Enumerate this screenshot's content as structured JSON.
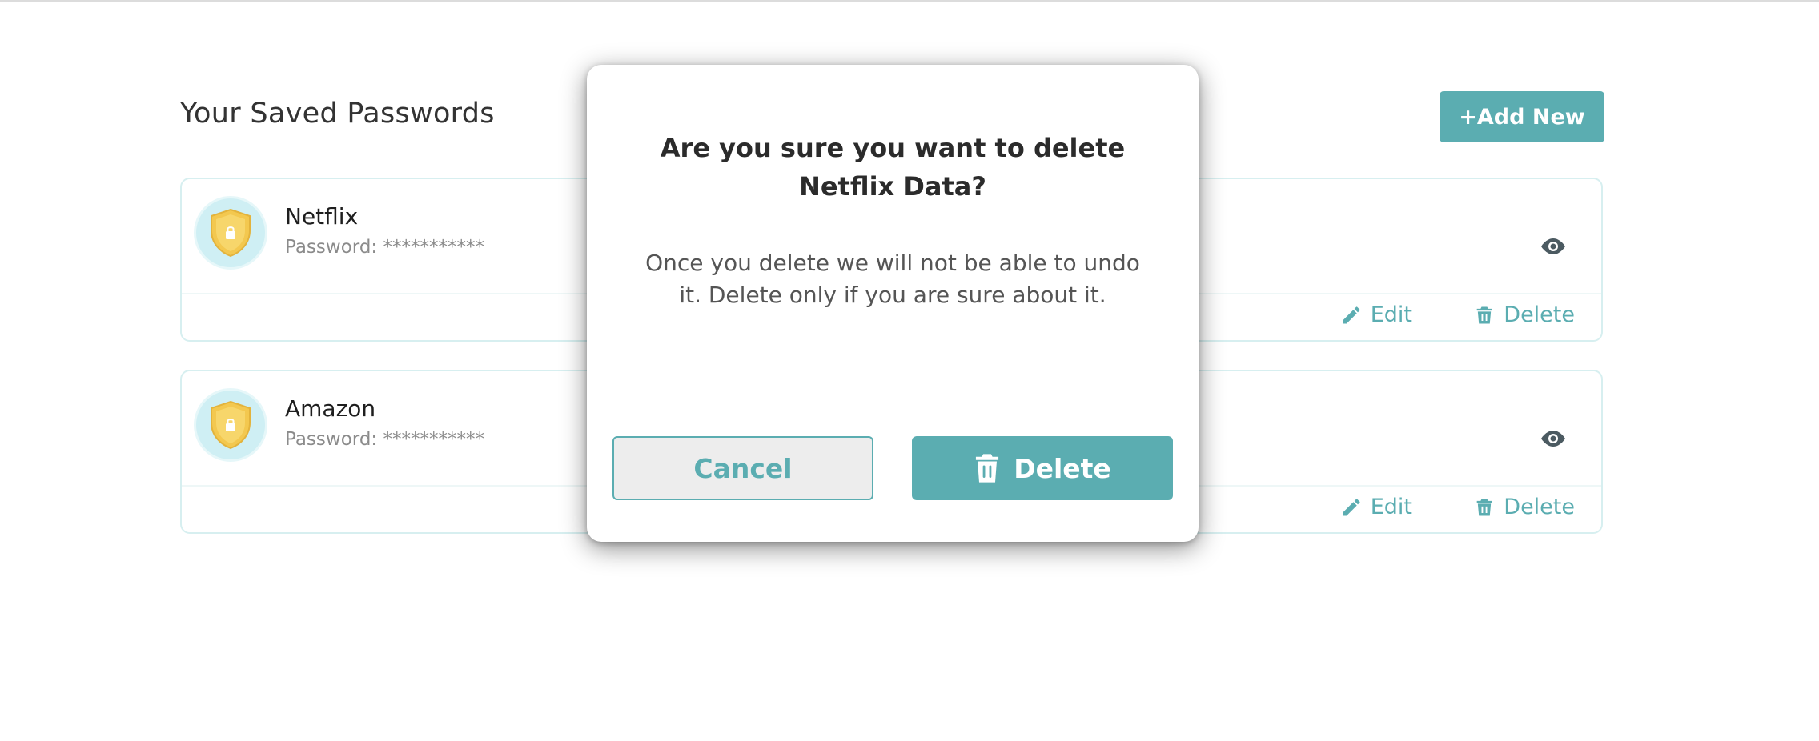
{
  "page": {
    "title": "Your Saved Passwords",
    "add_new_label": "+Add New"
  },
  "entries": [
    {
      "name": "Netflix",
      "password_label": "Password: ***********",
      "edit_label": "Edit",
      "delete_label": "Delete"
    },
    {
      "name": "Amazon",
      "password_label": "Password: ***********",
      "edit_label": "Edit",
      "delete_label": "Delete"
    }
  ],
  "modal": {
    "title": "Are you sure you want to delete Netflix Data?",
    "body": "Once you delete we will not be able to undo it. Delete only if you are sure about it.",
    "cancel_label": "Cancel",
    "delete_label": "Delete"
  },
  "icons": {
    "avatar": "shield-lock-icon",
    "view": "eye-icon",
    "edit": "pencil-icon",
    "delete": "trash-icon"
  },
  "colors": {
    "accent": "#5badb1",
    "card_border": "#d7eff0",
    "avatar_bg": "#cfeff4",
    "shield": "#f3c84f"
  }
}
